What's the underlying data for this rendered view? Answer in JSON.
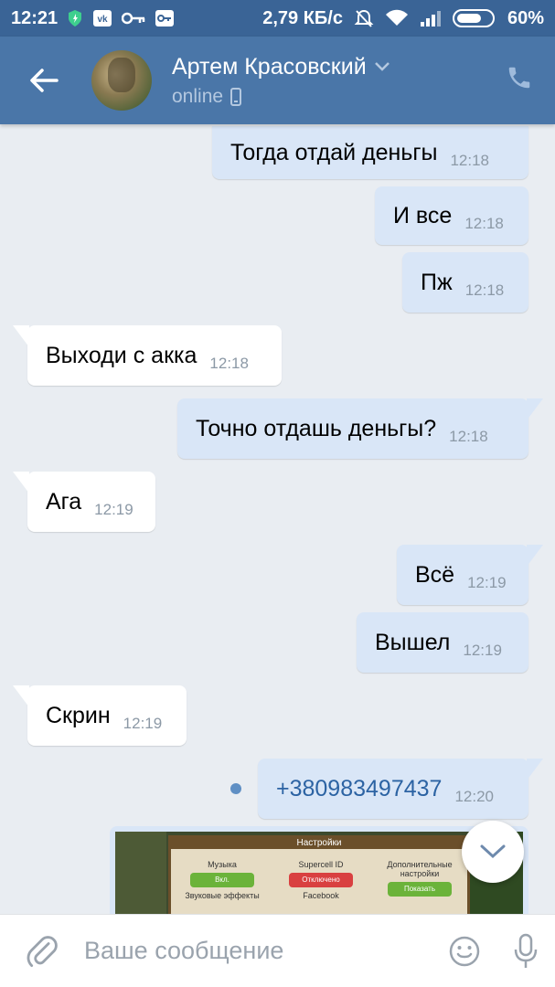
{
  "status_bar": {
    "time": "12:21",
    "speed": "2,79 КБ/с",
    "battery": "60%"
  },
  "header": {
    "name": "Артем Красовский",
    "status": "online"
  },
  "messages": [
    {
      "text": "Тогда отдай деньгы",
      "time": "12:18",
      "dir": "out"
    },
    {
      "text": "И все",
      "time": "12:18",
      "dir": "out"
    },
    {
      "text": "Пж",
      "time": "12:18",
      "dir": "out"
    },
    {
      "text": "Выходи с акка",
      "time": "12:18",
      "dir": "in"
    },
    {
      "text": "Точно отдашь деньгы?",
      "time": "12:18",
      "dir": "out"
    },
    {
      "text": "Ага",
      "time": "12:19",
      "dir": "in"
    },
    {
      "text": "Всё",
      "time": "12:19",
      "dir": "out"
    },
    {
      "text": "Вышел",
      "time": "12:19",
      "dir": "out"
    },
    {
      "text": "Скрин",
      "time": "12:19",
      "dir": "in"
    },
    {
      "text": "+380983497437",
      "time": "12:20",
      "dir": "out"
    }
  ],
  "attachment": {
    "panel_title": "Настройки",
    "col1_label": "Музыка",
    "col1_btn": "Вкл.",
    "col2_label": "Supercell ID",
    "col2_btn": "Отключено",
    "col3_label": "Дополнительные настройки",
    "col3_btn": "Показать",
    "col4_label": "Звуковые эффекты",
    "col5_label": "Facebook"
  },
  "composer": {
    "placeholder": "Ваше сообщение"
  },
  "colors": {
    "header": "#4a76a8",
    "status_bar": "#3a6496",
    "outgoing_bubble": "#d9e6f7",
    "incoming_bubble": "#ffffff",
    "chat_bg": "#e9edf2"
  }
}
